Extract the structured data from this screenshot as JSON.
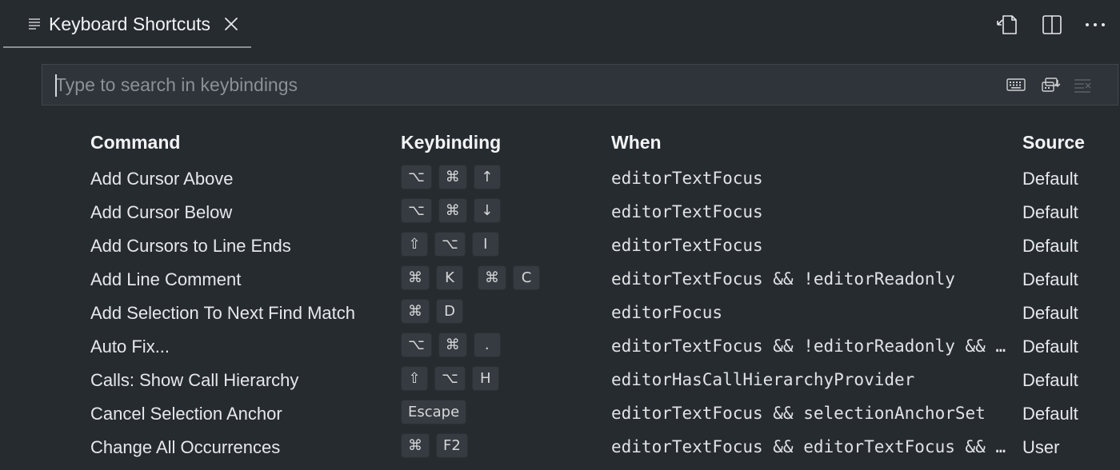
{
  "tab": {
    "title": "Keyboard Shortcuts"
  },
  "search": {
    "placeholder": "Type to search in keybindings",
    "value": ""
  },
  "columns": {
    "command": "Command",
    "keybinding": "Keybinding",
    "when": "When",
    "source": "Source"
  },
  "rows": [
    {
      "command": "Add Cursor Above",
      "chords": [
        [
          "⌥",
          "⌘",
          "↑"
        ]
      ],
      "when": "editorTextFocus",
      "source": "Default"
    },
    {
      "command": "Add Cursor Below",
      "chords": [
        [
          "⌥",
          "⌘",
          "↓"
        ]
      ],
      "when": "editorTextFocus",
      "source": "Default"
    },
    {
      "command": "Add Cursors to Line Ends",
      "chords": [
        [
          "⇧",
          "⌥",
          "I"
        ]
      ],
      "when": "editorTextFocus",
      "source": "Default"
    },
    {
      "command": "Add Line Comment",
      "chords": [
        [
          "⌘",
          "K"
        ],
        [
          "⌘",
          "C"
        ]
      ],
      "when": "editorTextFocus && !editorReadonly",
      "source": "Default"
    },
    {
      "command": "Add Selection To Next Find Match",
      "chords": [
        [
          "⌘",
          "D"
        ]
      ],
      "when": "editorFocus",
      "source": "Default"
    },
    {
      "command": "Auto Fix...",
      "chords": [
        [
          "⌥",
          "⌘",
          "."
        ]
      ],
      "when": "editorTextFocus && !editorReadonly && supportedCodeAction",
      "source": "Default"
    },
    {
      "command": "Calls: Show Call Hierarchy",
      "chords": [
        [
          "⇧",
          "⌥",
          "H"
        ]
      ],
      "when": "editorHasCallHierarchyProvider",
      "source": "Default"
    },
    {
      "command": "Cancel Selection Anchor",
      "chords": [
        [
          "Escape"
        ]
      ],
      "when": "editorTextFocus && selectionAnchorSet",
      "source": "Default"
    },
    {
      "command": "Change All Occurrences",
      "chords": [
        [
          "⌘",
          "F2"
        ]
      ],
      "when": "editorTextFocus && editorTextFocus && !editorReadonly",
      "source": "User"
    }
  ],
  "icons": {
    "tab": "keybindings-icon",
    "close": "close-icon",
    "open_json": "open-keybindings-json-icon",
    "split": "split-editor-icon",
    "more": "more-actions-icon",
    "record_keys": "record-keys-icon",
    "sort_precedence": "sort-by-precedence-icon",
    "clear": "clear-search-icon"
  }
}
